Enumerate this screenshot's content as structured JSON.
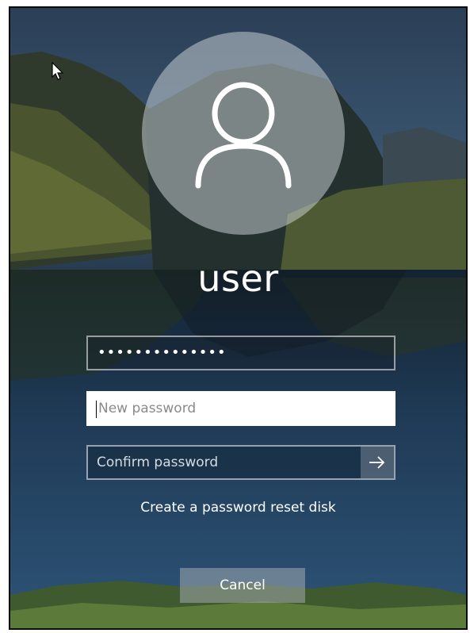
{
  "login": {
    "username": "user",
    "old_password_mask": "••••••••••••••",
    "new_password_placeholder": "New password",
    "confirm_password_placeholder": "Confirm password",
    "reset_disk_link": "Create a password reset disk",
    "cancel_label": "Cancel"
  },
  "icons": {
    "avatar": "user-avatar-icon",
    "submit": "arrow-right-icon",
    "pointer": "mouse-pointer-icon"
  },
  "colors": {
    "text": "#ffffff",
    "placeholder": "#8a8a8a",
    "frame": "#0b0b0b"
  }
}
